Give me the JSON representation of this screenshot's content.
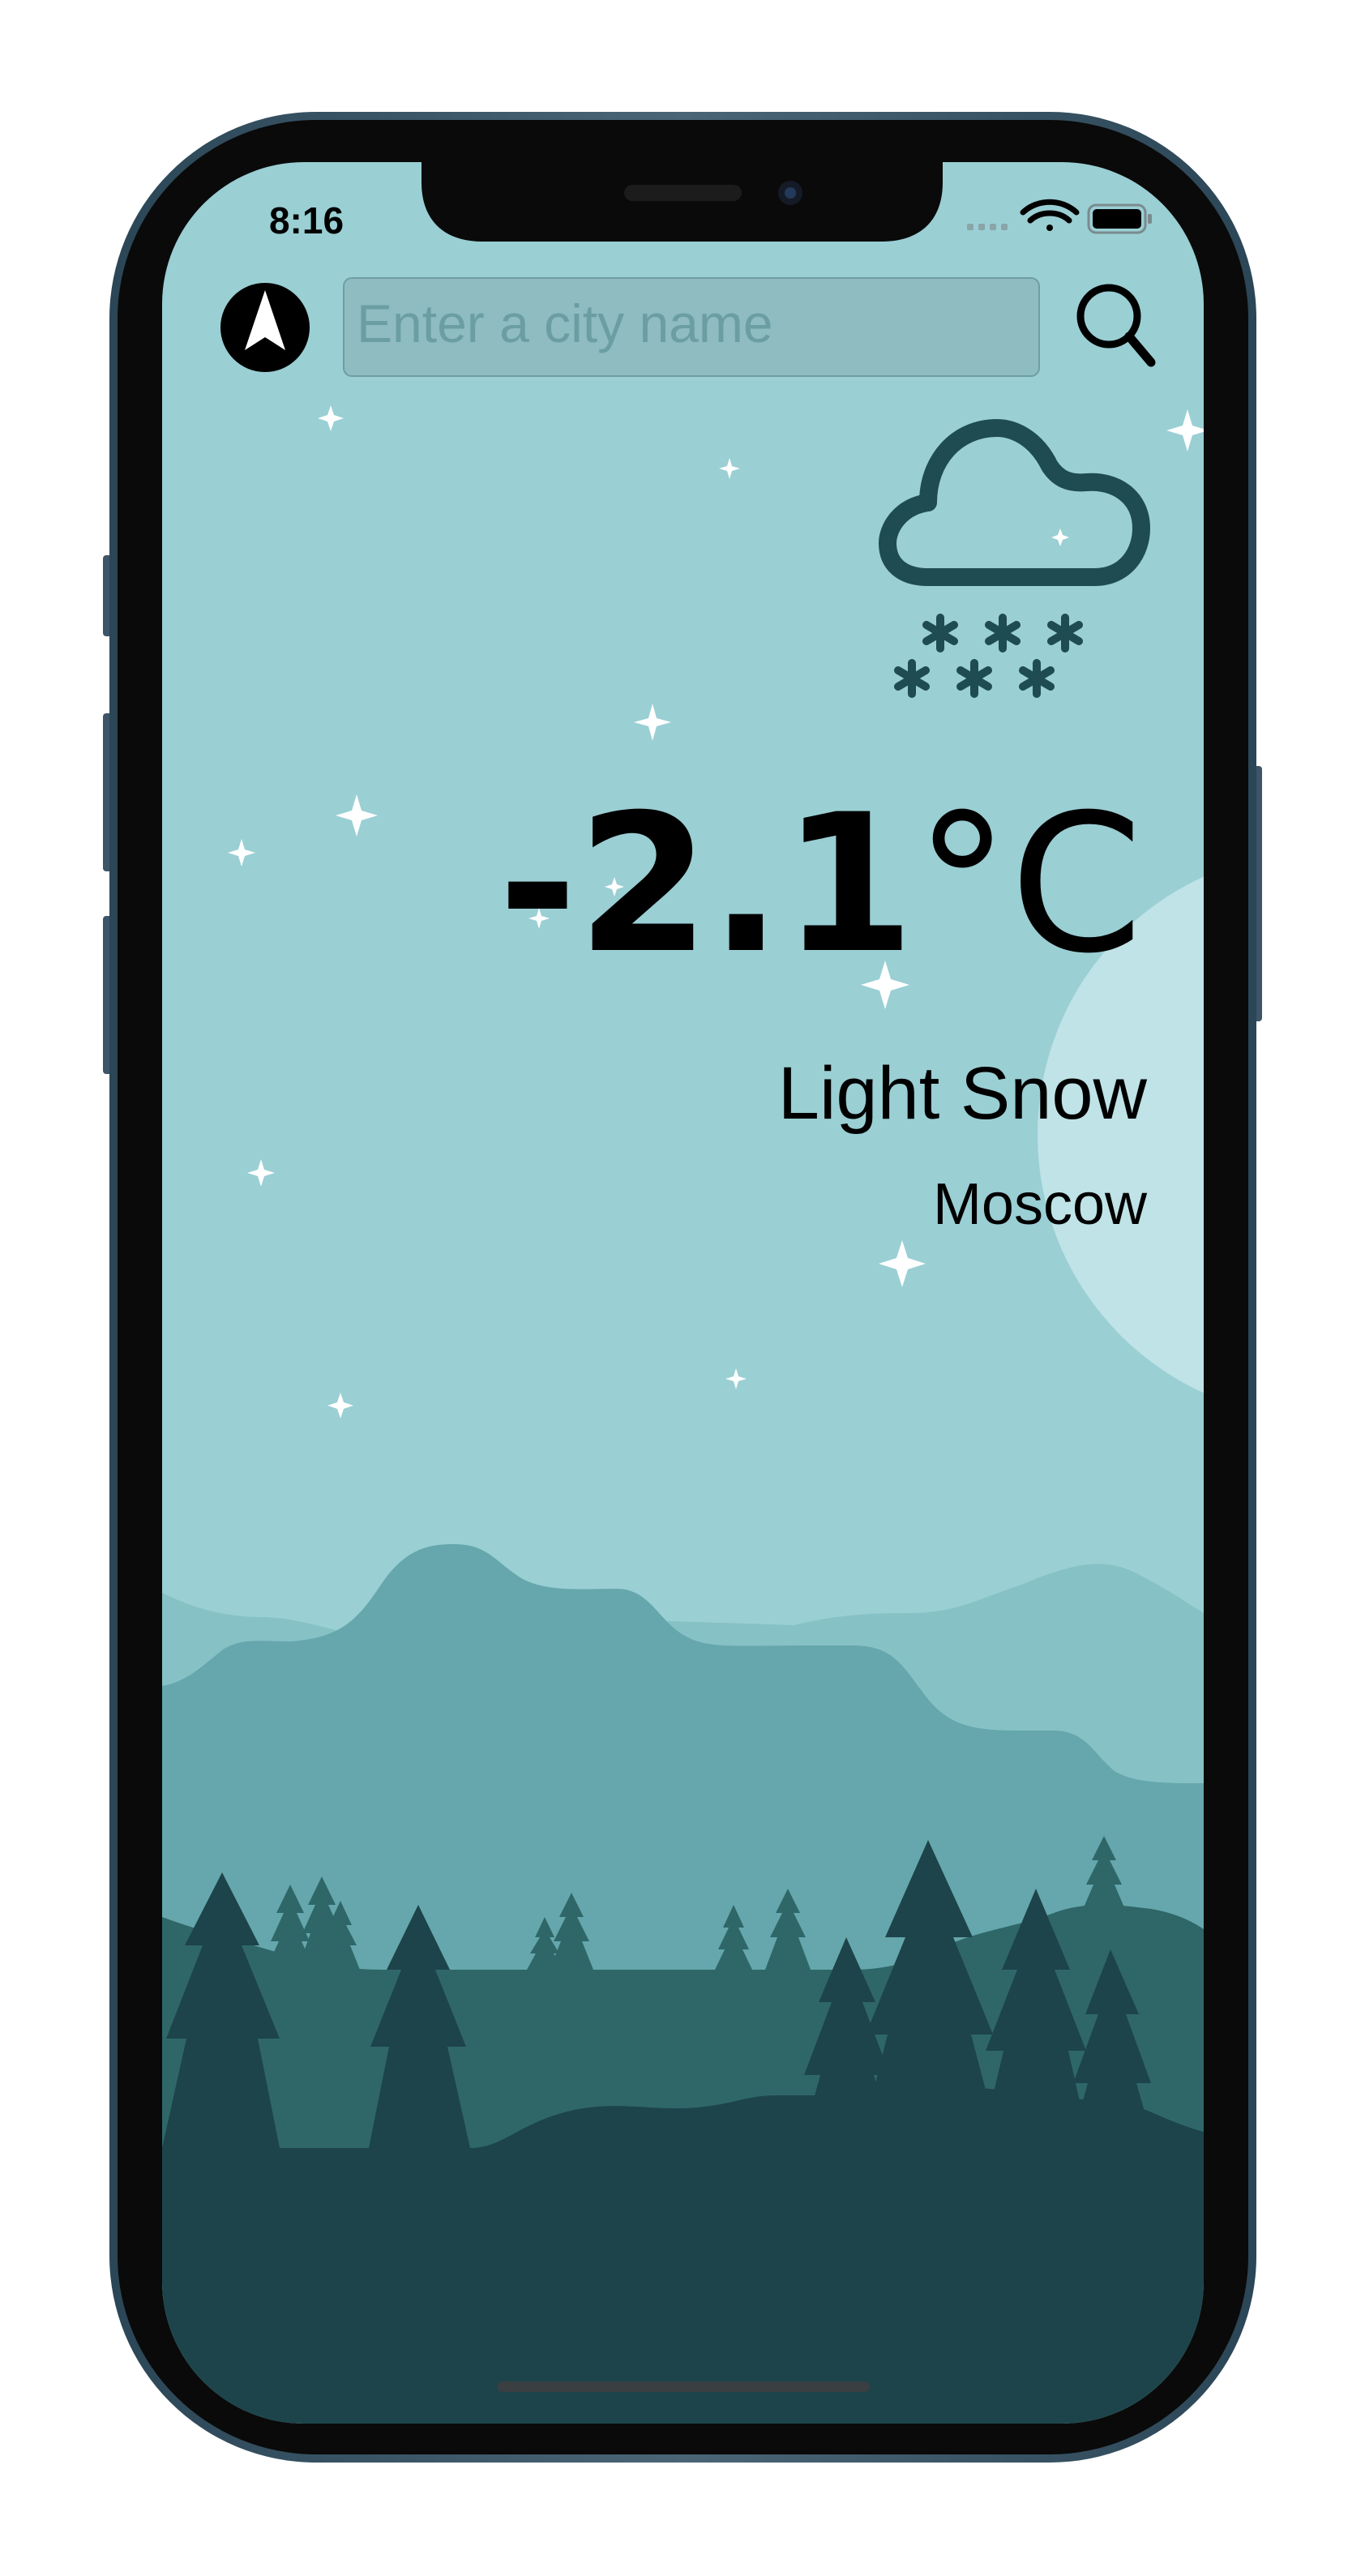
{
  "status_bar": {
    "time": "8:16"
  },
  "search": {
    "placeholder": "Enter a city name",
    "value": ""
  },
  "weather": {
    "temperature": "-2.1",
    "unit": "°C",
    "condition": "Light Snow",
    "city": "Moscow",
    "icon": "cloud-snow-icon"
  },
  "icons": {
    "location": "location-arrow-icon",
    "search": "magnifier-icon",
    "signal": "cellular-signal-icon",
    "wifi": "wifi-icon",
    "battery": "battery-icon"
  },
  "colors": {
    "sky": "#9acfd4",
    "moon": "#bfe3e7",
    "hills_light": "#86c1c6",
    "hills_mid": "#65a7ac",
    "forest": "#2f6769",
    "ground": "#1d444a",
    "icon_stroke": "#1e4c52",
    "phone_frame": "#0a0a0a"
  }
}
